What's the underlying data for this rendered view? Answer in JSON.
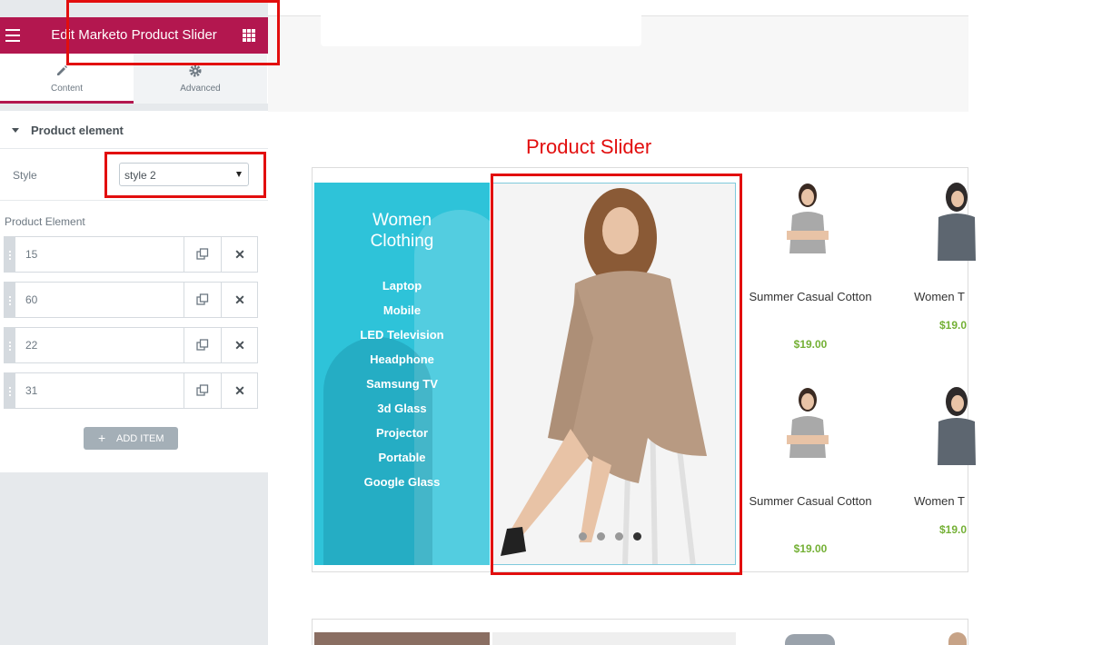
{
  "panel": {
    "title": "Edit Marketo Product Slider",
    "tabs": [
      {
        "label": "Content",
        "icon": "pencil-icon",
        "active": true
      },
      {
        "label": "Advanced",
        "icon": "gear-icon",
        "active": false
      }
    ],
    "section_title": "Product element",
    "style_label": "Style",
    "style_value": "style 2",
    "repeater_label": "Product Element",
    "items": [
      "15",
      "60",
      "22",
      "31"
    ],
    "add_item_label": "ADD ITEM",
    "accent_color": "#b3174f"
  },
  "preview": {
    "slider_title": "Product Slider",
    "category_heading": "Women Clothing",
    "categories": [
      "Laptop",
      "Mobile",
      "LED Television",
      "Headphone",
      "Samsung TV",
      "3d Glass",
      "Projector",
      "Portable",
      "Google Glass"
    ],
    "products": [
      {
        "name": "Summer Casual Cotton",
        "price": "$19.00"
      },
      {
        "name": "Women T",
        "price": "$19.0"
      },
      {
        "name": "Summer Casual Cotton",
        "price": "$19.00"
      },
      {
        "name": "Women T",
        "price": "$19.0"
      }
    ],
    "slider_dots": 4,
    "active_dot": 4,
    "price_color": "#74b035",
    "category_bg": "#2ec3d9",
    "annotation_color": "#e20e0e"
  }
}
